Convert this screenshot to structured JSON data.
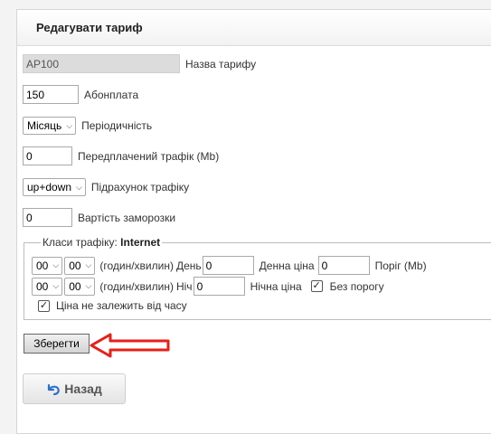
{
  "form": {
    "title": "Редагувати тариф",
    "tariff_name": {
      "value": "AP100",
      "label": "Назва тарифу"
    },
    "subscription_fee": {
      "value": "150",
      "label": "Абонплата"
    },
    "periodicity": {
      "selected": "Місяць",
      "label": "Періодичність"
    },
    "prepaid_traffic": {
      "value": "0",
      "label": "Передплачений трафік (Mb)"
    },
    "traffic_count": {
      "selected": "up+down",
      "label": "Підрахунок трафіку"
    },
    "freeze_cost": {
      "value": "0",
      "label": "Вартість заморозки"
    }
  },
  "traffic_classes": {
    "legend_prefix": "Класи трафіку:",
    "legend_class": "Internet",
    "day": {
      "hours": "00",
      "minutes": "00",
      "hint": "(годин/хвилин)",
      "label": "День",
      "value": "0",
      "price_label": "Денна ціна",
      "price_value": "0",
      "threshold_label": "Поріг (Mb)"
    },
    "night": {
      "hours": "00",
      "minutes": "00",
      "hint": "(годин/хвилин)",
      "label": "Ніч",
      "value": "0",
      "price_label": "Нічна ціна",
      "no_threshold_checked": true,
      "no_threshold_label": "Без порогу"
    },
    "time_independent_checked": true,
    "time_independent_label": "Ціна не залежить від часу"
  },
  "actions": {
    "save_label": "Зберегти",
    "back_label": "Назад"
  },
  "colors": {
    "annotation_arrow": "#e8201a",
    "back_icon": "#2f6fd1"
  }
}
